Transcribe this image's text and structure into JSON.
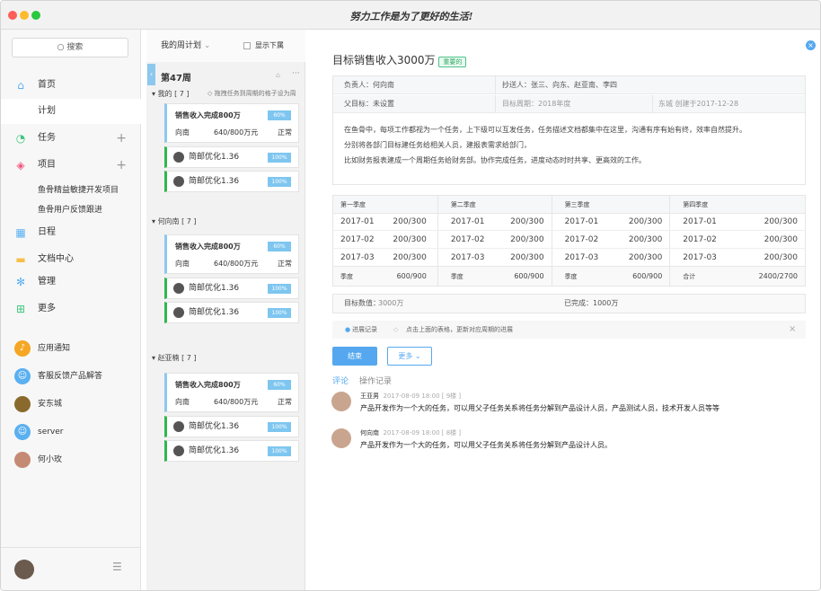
{
  "window": {
    "title": "努力工作是为了更好的生活!"
  },
  "sidebar": {
    "search_placeholder": "搜索",
    "nav": [
      {
        "label": "首页",
        "icon": "home-icon"
      },
      {
        "label": "计划",
        "icon": ""
      },
      {
        "label": "任务",
        "icon": "task-icon"
      },
      {
        "label": "项目",
        "icon": "layers-icon"
      },
      {
        "label": "日程",
        "icon": "calendar-icon"
      },
      {
        "label": "文档中心",
        "icon": "folder-icon"
      },
      {
        "label": "管理",
        "icon": "gear-icon"
      },
      {
        "label": "更多",
        "icon": "grid-icon"
      }
    ],
    "projects": [
      "鱼骨精益敏捷开发项目",
      "鱼骨用户反馈跟进"
    ],
    "apps": [
      {
        "label": "应用通知",
        "color": "#f5a623"
      },
      {
        "label": "客服反馈产品解答",
        "color": "#5ab0f0"
      },
      {
        "label": "安东城",
        "color": "#8a6a2c"
      },
      {
        "label": "server",
        "color": "#5ab0f0"
      },
      {
        "label": "何小玫",
        "color": "#c58a74"
      }
    ]
  },
  "plan": {
    "selector": "我的周计划",
    "show_sub": "显示下属",
    "week": "第47周",
    "hint": "拖拽任务到周期的格子设为周",
    "groups": [
      {
        "name": "我的 [ 7 ]",
        "task": {
          "title": "销售收入完成800万",
          "owner": "向南",
          "amount": "640/800万元",
          "status": "正常",
          "progress": "60%"
        },
        "subs": [
          {
            "title": "简邮优化1.36",
            "progress": "100%"
          },
          {
            "title": "简邮优化1.36",
            "progress": "100%"
          }
        ]
      },
      {
        "name": "何向南 [ 7 ]",
        "task": {
          "title": "销售收入完成800万",
          "owner": "向南",
          "amount": "640/800万元",
          "status": "正常",
          "progress": "60%"
        },
        "subs": [
          {
            "title": "简邮优化1.36",
            "progress": "100%"
          },
          {
            "title": "简邮优化1.36",
            "progress": "100%"
          }
        ]
      },
      {
        "name": "赵亚楠 [ 7 ]",
        "task": {
          "title": "销售收入完成800万",
          "owner": "向南",
          "amount": "640/800万元",
          "status": "正常",
          "progress": "60%"
        },
        "subs": [
          {
            "title": "简邮优化1.36",
            "progress": "100%"
          },
          {
            "title": "简邮优化1.36",
            "progress": "100%"
          }
        ]
      }
    ]
  },
  "detail": {
    "title": "目标销售收入3000万",
    "tag": "重要的",
    "owner": "负责人：何向南",
    "cc": "抄送人：张三、向东、赵亚南、李四",
    "parent": "父目标：未设置",
    "period_label": "目标周期：",
    "period": "2018年度",
    "creator": "东城 创建于2017-12-28",
    "desc": [
      "在鱼骨中，每项工作都视为一个任务，上下级可以互发任务，任务描述文档都集中在这里，沟通有序有始有终，效率自然提升。",
      "分别将各部门目标建任务给相关人员，建报表需求给部门，",
      "比如财务报表建成一个周期任务给财务部。协作完成任务，进度动态时时共享、更高效的工作。"
    ],
    "quarters": [
      {
        "name": "第一季度",
        "rows": [
          [
            "2017-01",
            "200/300"
          ],
          [
            "2017-02",
            "200/300"
          ],
          [
            "2017-03",
            "200/300"
          ]
        ],
        "total_label": "季度",
        "total": "600/900"
      },
      {
        "name": "第二季度",
        "rows": [
          [
            "2017-01",
            "200/300"
          ],
          [
            "2017-02",
            "200/300"
          ],
          [
            "2017-03",
            "200/300"
          ]
        ],
        "total_label": "季度",
        "total": "600/900"
      },
      {
        "name": "第三季度",
        "rows": [
          [
            "2017-01",
            "200/300"
          ],
          [
            "2017-02",
            "200/300"
          ],
          [
            "2017-03",
            "200/300"
          ]
        ],
        "total_label": "季度",
        "total": "600/900"
      },
      {
        "name": "第四季度",
        "rows": [
          [
            "2017-01",
            "200/300"
          ],
          [
            "2017-02",
            "200/300"
          ],
          [
            "2017-03",
            "200/300"
          ]
        ],
        "total_label": "合计",
        "total": "2400/2700"
      }
    ],
    "target_label": "目标数值：",
    "target_value": "3000万",
    "done": "已完成：1000万",
    "progress_log": "进展记录",
    "progress_hint": "点击上面的表格，更新对应周期的进展",
    "end_btn": "结束",
    "more_btn": "更多",
    "tabs": [
      "评论",
      "操作记录"
    ],
    "comments": [
      {
        "name": "王亚男",
        "time": "2017-08-09 18:00 [ 9楼 ]",
        "text": "产品开发作为一个大的任务，可以用父子任务关系将任务分解到产品设计人员，产品测试人员，技术开发人员等等"
      },
      {
        "name": "何向南",
        "time": "2017-08-09 18:00 [ 8楼 ]",
        "text": "产品开发作为一个大的任务，可以用父子任务关系将任务分解到产品设计人员。"
      }
    ]
  }
}
